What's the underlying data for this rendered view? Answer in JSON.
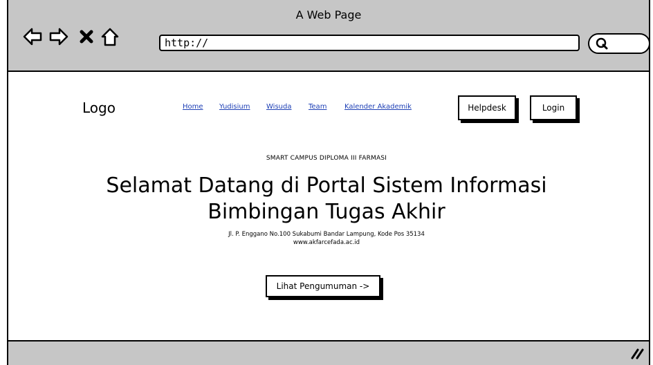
{
  "window": {
    "title": "A Web Page"
  },
  "browser": {
    "url": "http://",
    "back_icon": "back-arrow-icon",
    "forward_icon": "forward-arrow-icon",
    "stop_icon": "close-icon",
    "home_icon": "home-icon",
    "search_icon": "search-icon"
  },
  "header": {
    "logo": "Logo",
    "nav": [
      "Home",
      "Yudisium",
      "Wisuda",
      "Team",
      "Kalender Akademik"
    ],
    "helpdesk_label": "Helpdesk",
    "login_label": "Login"
  },
  "hero": {
    "subtitle": "SMART CAMPUS DIPLOMA III FARMASI",
    "headline_line1": "Selamat Datang di Portal Sistem Informasi",
    "headline_line2": "Bimbingan Tugas Akhir",
    "address": "Jl. P. Enggano No.100 Sukabumi Bandar Lampung, Kode Pos 35134",
    "website": "www.akfarcefada.ac.id",
    "cta_label": "Lihat Pengumuman ->"
  },
  "colors": {
    "chrome": "#c6c6c6",
    "link": "#1d3fb5"
  }
}
